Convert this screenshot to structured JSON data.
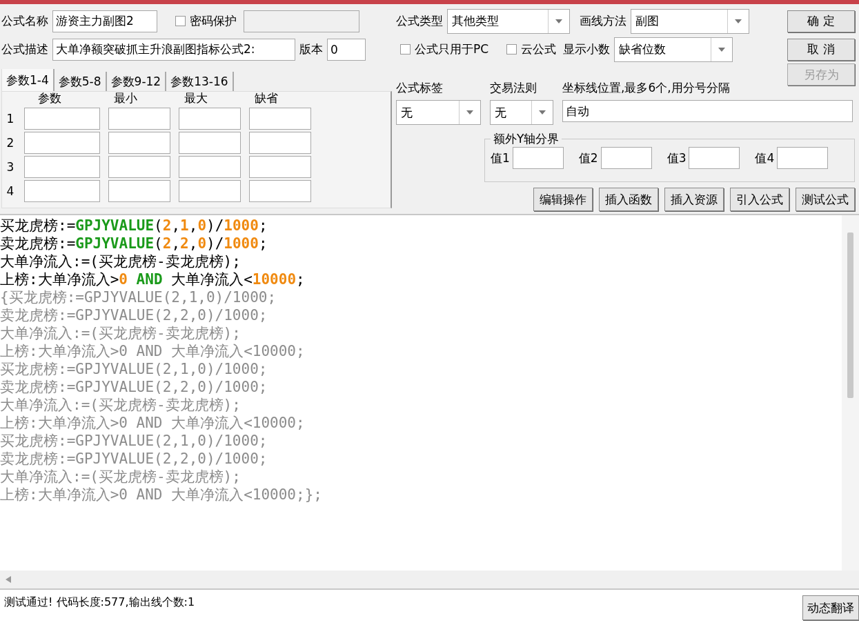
{
  "formula_name": {
    "label": "公式名称",
    "value": "游资主力副图2"
  },
  "password": {
    "label": "密码保护",
    "checked": false
  },
  "description": {
    "label": "公式描述",
    "value": "大单净额突破抓主升浪副图指标公式2:"
  },
  "version": {
    "label": "版本",
    "value": "0"
  },
  "param_tabs": [
    {
      "label": "参数1-4",
      "selected": true
    },
    {
      "label": "参数5-8",
      "selected": false
    },
    {
      "label": "参数9-12",
      "selected": false
    },
    {
      "label": "参数13-16",
      "selected": false
    }
  ],
  "param_columns": [
    "参数",
    "最小",
    "最大",
    "缺省"
  ],
  "param_rows": [
    "1",
    "2",
    "3",
    "4"
  ],
  "formula_type": {
    "label": "公式类型",
    "value": "其他类型"
  },
  "draw_method": {
    "label": "画线方法",
    "value": "副图"
  },
  "pc_only": {
    "label": "公式只用于PC",
    "checked": false
  },
  "cloud": {
    "label": "云公式",
    "checked": false
  },
  "decimals": {
    "label": "显示小数",
    "value": "缺省位数"
  },
  "buttons": [
    {
      "label": "确 定",
      "disabled": false
    },
    {
      "label": "取 消",
      "disabled": false
    },
    {
      "label": "另存为",
      "disabled": true
    }
  ],
  "tag": {
    "label": "公式标签",
    "value": "无"
  },
  "rule": {
    "label": "交易法则",
    "value": "无"
  },
  "axis": {
    "label": "坐标线位置,最多6个,用分号分隔",
    "value": "自动"
  },
  "extra_y": {
    "title": "额外Y轴分界",
    "fields": [
      "值1",
      "值2",
      "值3",
      "值4"
    ]
  },
  "tools": [
    "编辑操作",
    "插入函数",
    "插入资源",
    "引入公式",
    "测试公式"
  ],
  "code_lines": [
    [
      {
        "kind": "text",
        "text": "买龙虎榜:="
      },
      {
        "kind": "func",
        "text": "GPJYVALUE"
      },
      {
        "kind": "text",
        "text": "("
      },
      {
        "kind": "num",
        "text": "2"
      },
      {
        "kind": "text",
        "text": ","
      },
      {
        "kind": "num",
        "text": "1"
      },
      {
        "kind": "text",
        "text": ","
      },
      {
        "kind": "num",
        "text": "0"
      },
      {
        "kind": "text",
        "text": ")/"
      },
      {
        "kind": "num",
        "text": "1000"
      },
      {
        "kind": "text",
        "text": ";"
      }
    ],
    [
      {
        "kind": "text",
        "text": "卖龙虎榜:="
      },
      {
        "kind": "func",
        "text": "GPJYVALUE"
      },
      {
        "kind": "text",
        "text": "("
      },
      {
        "kind": "num",
        "text": "2"
      },
      {
        "kind": "text",
        "text": ","
      },
      {
        "kind": "num",
        "text": "2"
      },
      {
        "kind": "text",
        "text": ","
      },
      {
        "kind": "num",
        "text": "0"
      },
      {
        "kind": "text",
        "text": ")/"
      },
      {
        "kind": "num",
        "text": "1000"
      },
      {
        "kind": "text",
        "text": ";"
      }
    ],
    [
      {
        "kind": "text",
        "text": "大单净流入:=(买龙虎榜-卖龙虎榜);"
      }
    ],
    [
      {
        "kind": "text",
        "text": "上榜:大单净流入>"
      },
      {
        "kind": "num",
        "text": "0"
      },
      {
        "kind": "func",
        "text": " AND"
      },
      {
        "kind": "text",
        "text": " 大单净流入<"
      },
      {
        "kind": "num",
        "text": "10000"
      },
      {
        "kind": "text",
        "text": ";"
      }
    ],
    [
      {
        "kind": "comment",
        "text": "{买龙虎榜:=GPJYVALUE(2,1,0)/1000;"
      }
    ],
    [
      {
        "kind": "comment",
        "text": "卖龙虎榜:=GPJYVALUE(2,2,0)/1000;"
      }
    ],
    [
      {
        "kind": "comment",
        "text": "大单净流入:=(买龙虎榜-卖龙虎榜);"
      }
    ],
    [
      {
        "kind": "comment",
        "text": "上榜:大单净流入>0 AND 大单净流入<10000;"
      }
    ],
    [
      {
        "kind": "comment",
        "text": "买龙虎榜:=GPJYVALUE(2,1,0)/1000;"
      }
    ],
    [
      {
        "kind": "comment",
        "text": "卖龙虎榜:=GPJYVALUE(2,2,0)/1000;"
      }
    ],
    [
      {
        "kind": "comment",
        "text": "大单净流入:=(买龙虎榜-卖龙虎榜);"
      }
    ],
    [
      {
        "kind": "comment",
        "text": "上榜:大单净流入>0 AND 大单净流入<10000;"
      }
    ],
    [
      {
        "kind": "comment",
        "text": "买龙虎榜:=GPJYVALUE(2,1,0)/1000;"
      }
    ],
    [
      {
        "kind": "comment",
        "text": "卖龙虎榜:=GPJYVALUE(2,2,0)/1000;"
      }
    ],
    [
      {
        "kind": "comment",
        "text": "大单净流入:=(买龙虎榜-卖龙虎榜);"
      }
    ],
    [
      {
        "kind": "comment",
        "text": "上榜:大单净流入>0 AND 大单净流入<10000;};"
      }
    ]
  ],
  "status": "测试通过! 代码长度:577,输出线个数:1",
  "translate_button": "动态翻译"
}
